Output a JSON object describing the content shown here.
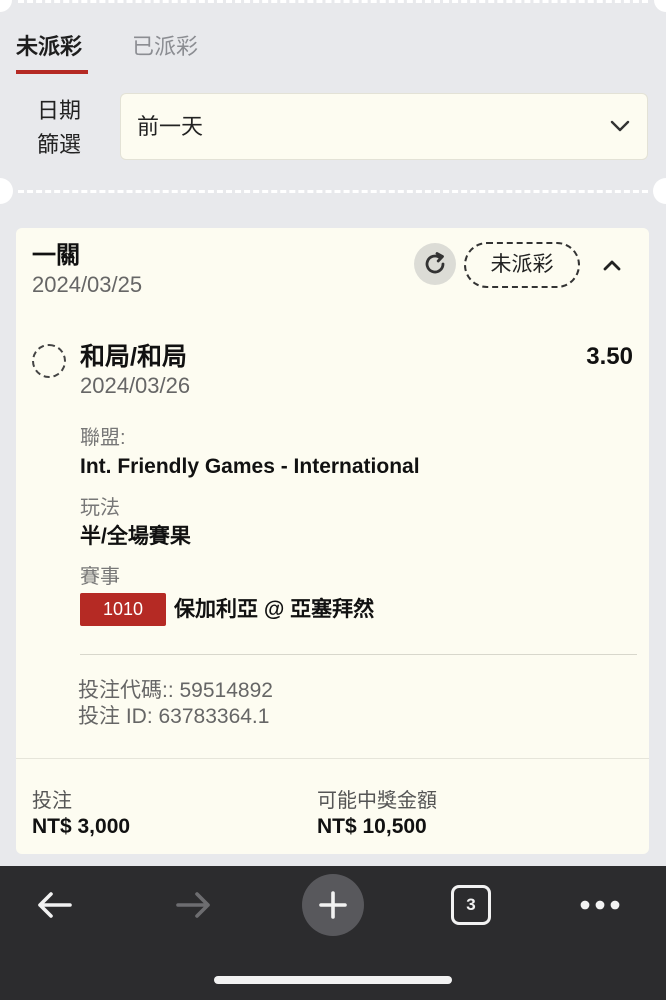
{
  "tabs": {
    "active": "未派彩",
    "inactive": "已派彩"
  },
  "filter": {
    "label_line1": "日期",
    "label_line2": "篩選",
    "selected": "前一天"
  },
  "bet": {
    "type": "一關",
    "placed_date": "2024/03/25",
    "status": "未派彩",
    "selection": {
      "name": "和局/和局",
      "odds": "3.50",
      "event_date": "2024/03/26",
      "league_label": "聯盟:",
      "league": "Int. Friendly Games - International",
      "market_label": "玩法",
      "market": "半/全場賽果",
      "event_label": "賽事",
      "event_number": "1010",
      "event_name": "保加利亞 @ 亞塞拜然"
    },
    "bet_code": "投注代碼:: 59514892",
    "bet_id": "投注 ID: 63783364.1",
    "stake_label": "投注",
    "stake": "NT$ 3,000",
    "payout_label": "可能中獎金額",
    "payout": "NT$ 10,500"
  },
  "browser": {
    "tab_count": "3"
  },
  "colors": {
    "accent": "#b52a24",
    "card": "#fdfcf1",
    "background": "#e8e9ec",
    "toolbar": "#2c2c2e"
  }
}
